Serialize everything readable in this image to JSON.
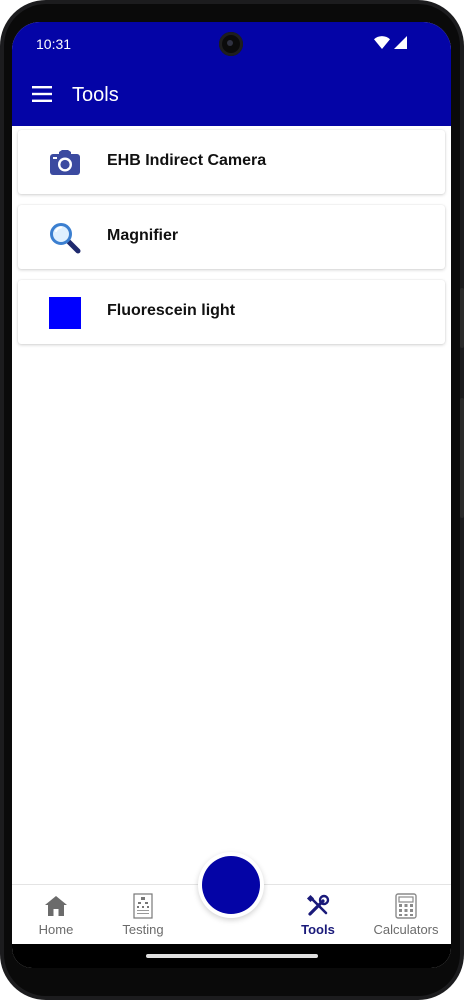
{
  "status_bar": {
    "time": "10:31",
    "icons": [
      "wifi-icon",
      "cellular-signal-icon"
    ]
  },
  "app_bar": {
    "title": "Tools",
    "menu_icon": "hamburger-menu-icon",
    "color": "#0404a6"
  },
  "tools": [
    {
      "label": "EHB Indirect Camera",
      "icon": "camera-icon"
    },
    {
      "label": "Magnifier",
      "icon": "magnifier-icon"
    },
    {
      "label": "Fluorescein light",
      "icon": "blue-square-icon",
      "color": "#0000ff"
    }
  ],
  "bottom_nav": {
    "items": [
      {
        "label": "Home",
        "icon": "home-icon",
        "active": false
      },
      {
        "label": "Testing",
        "icon": "eye-chart-icon",
        "active": false
      },
      {
        "label": "Tools",
        "icon": "tools-icon",
        "active": true
      },
      {
        "label": "Calculators",
        "icon": "calculator-icon",
        "active": false
      }
    ],
    "fab_color": "#0404a6"
  }
}
